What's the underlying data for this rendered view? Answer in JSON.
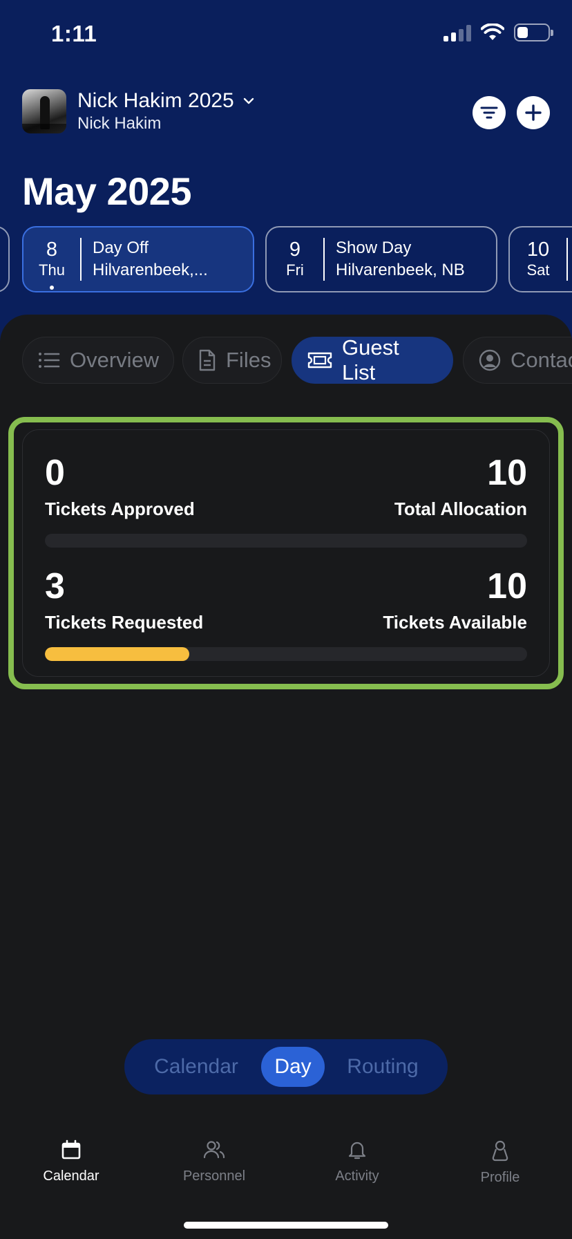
{
  "status_bar": {
    "time": "1:11",
    "battery_percent": 35
  },
  "header": {
    "tour_title": "Nick Hakim 2025",
    "artist_name": "Nick Hakim",
    "filter_icon": "filter-icon",
    "add_icon": "plus-icon"
  },
  "month_title": "May 2025",
  "days": [
    {
      "num": "8",
      "dow": "Thu",
      "type": "Day Off",
      "location": "Hilvarenbeek,...",
      "selected": true
    },
    {
      "num": "9",
      "dow": "Fri",
      "type": "Show Day",
      "location": "Hilvarenbeek, NB",
      "selected": false
    },
    {
      "num": "10",
      "dow": "Sat",
      "type": "",
      "location": "",
      "selected": false
    }
  ],
  "tabs": [
    {
      "label": "Overview",
      "icon": "list-icon"
    },
    {
      "label": "Files",
      "icon": "file-icon"
    },
    {
      "label": "Guest List",
      "icon": "ticket-icon",
      "active": true
    },
    {
      "label": "Contac",
      "icon": "user-circle-icon"
    }
  ],
  "guest_stats": {
    "approved_value": "0",
    "approved_label": "Tickets Approved",
    "allocation_value": "10",
    "allocation_label": "Total Allocation",
    "approved_fraction": 0,
    "requested_value": "3",
    "requested_label": "Tickets Requested",
    "available_value": "10",
    "available_label": "Tickets Available",
    "requested_fraction": 0.3
  },
  "view_switch": {
    "options": [
      "Calendar",
      "Day",
      "Routing"
    ],
    "selected": "Day"
  },
  "bottom_nav": [
    {
      "label": "Calendar",
      "icon": "calendar-icon",
      "active": true
    },
    {
      "label": "Personnel",
      "icon": "people-icon"
    },
    {
      "label": "Activity",
      "icon": "bell-icon"
    },
    {
      "label": "Profile",
      "icon": "person-icon"
    }
  ],
  "colors": {
    "header_bg": "#0a1f5c",
    "sheet_bg": "#18191b",
    "accent_blue": "#17357f",
    "highlight_green": "#86bd4f",
    "progress_yellow": "#f7be3f"
  }
}
